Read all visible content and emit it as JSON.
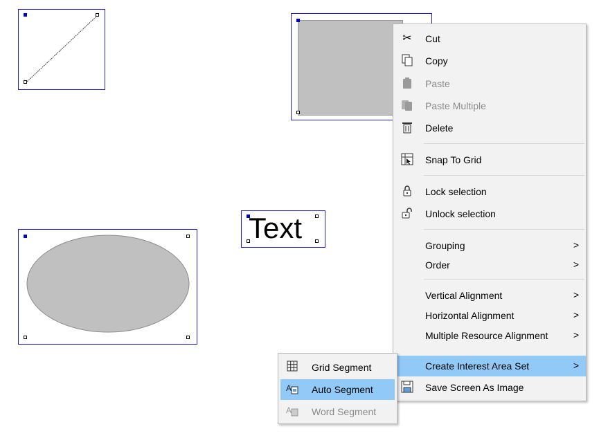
{
  "canvas": {
    "text_object": "Text"
  },
  "context_menu": {
    "items": [
      {
        "label": "Cut",
        "icon": "scissors-icon",
        "enabled": true
      },
      {
        "label": "Copy",
        "icon": "copy-icon",
        "enabled": true
      },
      {
        "label": "Paste",
        "icon": "paste-icon",
        "enabled": false
      },
      {
        "label": "Paste Multiple",
        "icon": "paste-multiple-icon",
        "enabled": false
      },
      {
        "label": "Delete",
        "icon": "trash-icon",
        "enabled": true
      },
      {
        "label": "Snap To Grid",
        "icon": "snap-grid-icon",
        "enabled": true
      },
      {
        "label": "Lock selection",
        "icon": "lock-icon",
        "enabled": true
      },
      {
        "label": "Unlock selection",
        "icon": "unlock-icon",
        "enabled": true
      },
      {
        "label": "Grouping",
        "submenu": true
      },
      {
        "label": "Order",
        "submenu": true
      },
      {
        "label": "Vertical Alignment",
        "submenu": true
      },
      {
        "label": "Horizontal Alignment",
        "submenu": true
      },
      {
        "label": "Multiple Resource Alignment",
        "submenu": true
      },
      {
        "label": "Create Interest Area Set",
        "submenu": true,
        "highlighted": true
      },
      {
        "label": "Save Screen As Image",
        "icon": "save-image-icon",
        "enabled": true
      }
    ],
    "arrow": ">"
  },
  "submenu": {
    "items": [
      {
        "label": "Grid Segment",
        "icon": "grid-icon",
        "enabled": true
      },
      {
        "label": "Auto Segment",
        "icon": "auto-segment-icon",
        "enabled": true,
        "highlighted": true
      },
      {
        "label": "Word Segment",
        "icon": "word-segment-icon",
        "enabled": false
      }
    ]
  },
  "colors": {
    "selection": "#1f1fd0",
    "highlight": "#91c9f7",
    "shape_fill": "#c0c0c0"
  }
}
